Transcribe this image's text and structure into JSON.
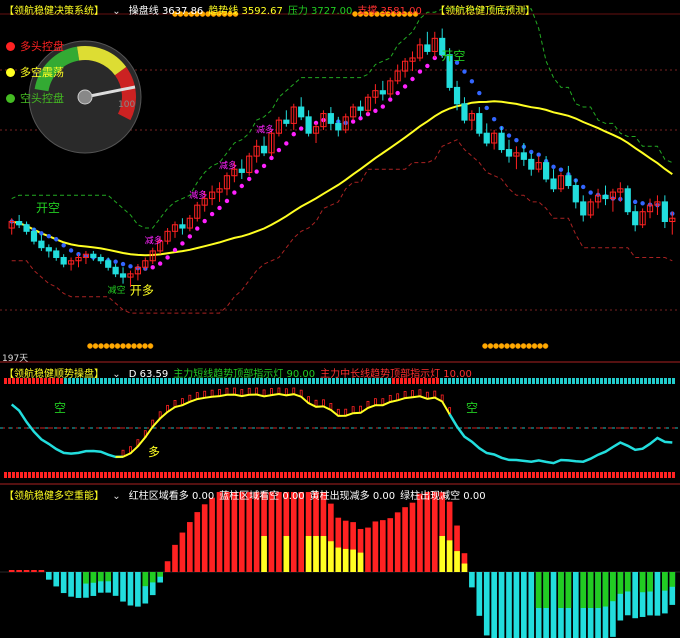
{
  "colors": {
    "bull": "#ff2222",
    "bear": "#22dddd",
    "pink": "#ff22ff",
    "blue": "#3366ff",
    "yellow": "#ffff22",
    "green": "#22cc22",
    "orange": "#ff8800",
    "header_red": "#ff3030",
    "header_green": "#22cc22"
  },
  "panel1": {
    "title": "【领航稳健决策系统】",
    "dropdown_icon": "chevron-down-icon",
    "items": [
      {
        "label": "操盘线",
        "value": "3637.86",
        "color": "#ffffff"
      },
      {
        "label": "趋势线",
        "value": "3592.67",
        "color": "#ffff22"
      },
      {
        "label": "压力",
        "value": "3727.00",
        "color": "#22cc22"
      },
      {
        "label": "支撑",
        "value": "3581.00",
        "color": "#ff3030"
      }
    ],
    "title2": "【领航稳健顶底预测】",
    "legend": [
      {
        "label": "多头控盘",
        "color": "#ff2222"
      },
      {
        "label": "多空震荡",
        "color": "#ffff22"
      },
      {
        "label": "空头控盘",
        "color": "#44bb22"
      }
    ],
    "gauge_value": "100",
    "annotations": [
      "开空",
      "开多",
      "减多",
      "减多",
      "减多",
      "减多",
      "减空",
      "开空"
    ],
    "days": "197天"
  },
  "panel2": {
    "title": "【领航稳健顺势操盘】",
    "items": [
      {
        "label": "D",
        "value": "63.59",
        "color": "#ffffff"
      },
      {
        "label": "主力短线趋势顶部指示灯",
        "value": "90.00",
        "color": "#22cc22"
      },
      {
        "label": "主力中长线趋势顶部指示灯",
        "value": "10.00",
        "color": "#ff3030"
      }
    ],
    "annotations": [
      "空",
      "多",
      "空"
    ]
  },
  "panel3": {
    "title": "【领航稳健多空重能】",
    "items": [
      {
        "label": "红柱区域看多",
        "value": "0.00",
        "color": "#ffffff"
      },
      {
        "label": "蓝柱区域看空",
        "value": "0.00",
        "color": "#ffffff"
      },
      {
        "label": "黄柱出现减多",
        "value": "0.00",
        "color": "#ffffff"
      },
      {
        "label": "绿柱出现减空",
        "value": "0.00",
        "color": "#ffffff"
      }
    ]
  },
  "chart_data": {
    "type": "candlestick",
    "candles": [
      [
        52,
        55,
        50,
        54
      ],
      [
        54,
        56,
        52,
        53
      ],
      [
        53,
        54,
        50,
        51
      ],
      [
        51,
        52,
        47,
        48
      ],
      [
        48,
        50,
        45,
        46
      ],
      [
        46,
        47,
        43,
        45
      ],
      [
        45,
        46,
        42,
        43
      ],
      [
        43,
        44,
        40,
        41
      ],
      [
        41,
        43,
        39,
        42
      ],
      [
        42,
        44,
        40,
        43
      ],
      [
        43,
        45,
        41,
        44
      ],
      [
        44,
        45,
        42,
        43
      ],
      [
        43,
        44,
        41,
        42
      ],
      [
        42,
        43,
        39,
        40
      ],
      [
        40,
        41,
        37,
        38
      ],
      [
        38,
        40,
        35,
        37
      ],
      [
        37,
        39,
        34,
        38
      ],
      [
        38,
        41,
        36,
        40
      ],
      [
        40,
        43,
        39,
        42
      ],
      [
        42,
        46,
        41,
        45
      ],
      [
        45,
        49,
        44,
        48
      ],
      [
        48,
        52,
        47,
        51
      ],
      [
        51,
        54,
        49,
        53
      ],
      [
        53,
        55,
        50,
        52
      ],
      [
        52,
        56,
        51,
        55
      ],
      [
        55,
        60,
        54,
        59
      ],
      [
        59,
        63,
        57,
        61
      ],
      [
        61,
        65,
        59,
        63
      ],
      [
        63,
        66,
        60,
        64
      ],
      [
        64,
        69,
        62,
        68
      ],
      [
        68,
        72,
        66,
        70
      ],
      [
        70,
        73,
        67,
        69
      ],
      [
        69,
        75,
        68,
        74
      ],
      [
        74,
        79,
        72,
        77
      ],
      [
        77,
        80,
        74,
        75
      ],
      [
        75,
        82,
        74,
        81
      ],
      [
        81,
        86,
        80,
        85
      ],
      [
        85,
        88,
        83,
        84
      ],
      [
        84,
        90,
        82,
        89
      ],
      [
        89,
        92,
        85,
        86
      ],
      [
        86,
        88,
        80,
        81
      ],
      [
        81,
        84,
        78,
        83
      ],
      [
        83,
        88,
        82,
        87
      ],
      [
        87,
        89,
        82,
        84
      ],
      [
        84,
        86,
        80,
        82
      ],
      [
        82,
        87,
        81,
        86
      ],
      [
        86,
        90,
        85,
        89
      ],
      [
        89,
        91,
        86,
        88
      ],
      [
        88,
        93,
        87,
        92
      ],
      [
        92,
        96,
        90,
        94
      ],
      [
        94,
        97,
        91,
        93
      ],
      [
        93,
        98,
        92,
        97
      ],
      [
        97,
        102,
        96,
        100
      ],
      [
        100,
        104,
        98,
        103
      ],
      [
        103,
        106,
        100,
        104
      ],
      [
        104,
        110,
        103,
        108
      ],
      [
        108,
        112,
        105,
        106
      ],
      [
        106,
        112,
        104,
        110
      ],
      [
        110,
        113,
        104,
        105
      ],
      [
        105,
        107,
        94,
        95
      ],
      [
        95,
        97,
        88,
        90
      ],
      [
        90,
        92,
        84,
        85
      ],
      [
        85,
        88,
        82,
        87
      ],
      [
        87,
        89,
        80,
        81
      ],
      [
        81,
        84,
        77,
        78
      ],
      [
        78,
        82,
        76,
        81
      ],
      [
        81,
        83,
        75,
        76
      ],
      [
        76,
        79,
        72,
        74
      ],
      [
        74,
        77,
        70,
        75
      ],
      [
        75,
        78,
        71,
        73
      ],
      [
        73,
        75,
        68,
        70
      ],
      [
        70,
        74,
        69,
        72
      ],
      [
        72,
        74,
        66,
        67
      ],
      [
        67,
        70,
        63,
        64
      ],
      [
        64,
        69,
        63,
        68
      ],
      [
        68,
        71,
        64,
        65
      ],
      [
        65,
        67,
        58,
        60
      ],
      [
        60,
        62,
        54,
        56
      ],
      [
        56,
        61,
        55,
        60
      ],
      [
        60,
        64,
        58,
        62
      ],
      [
        62,
        65,
        59,
        61
      ],
      [
        61,
        64,
        57,
        63
      ],
      [
        63,
        66,
        60,
        64
      ],
      [
        64,
        65,
        56,
        57
      ],
      [
        57,
        59,
        51,
        53
      ],
      [
        53,
        58,
        52,
        57
      ],
      [
        57,
        61,
        55,
        59
      ],
      [
        59,
        62,
        56,
        60
      ],
      [
        60,
        62,
        52,
        54
      ],
      [
        54,
        57,
        50,
        55
      ]
    ],
    "y_range": [
      30,
      115
    ],
    "panel2_range": [
      0,
      100
    ],
    "panel3_range": [
      -50,
      60
    ]
  }
}
